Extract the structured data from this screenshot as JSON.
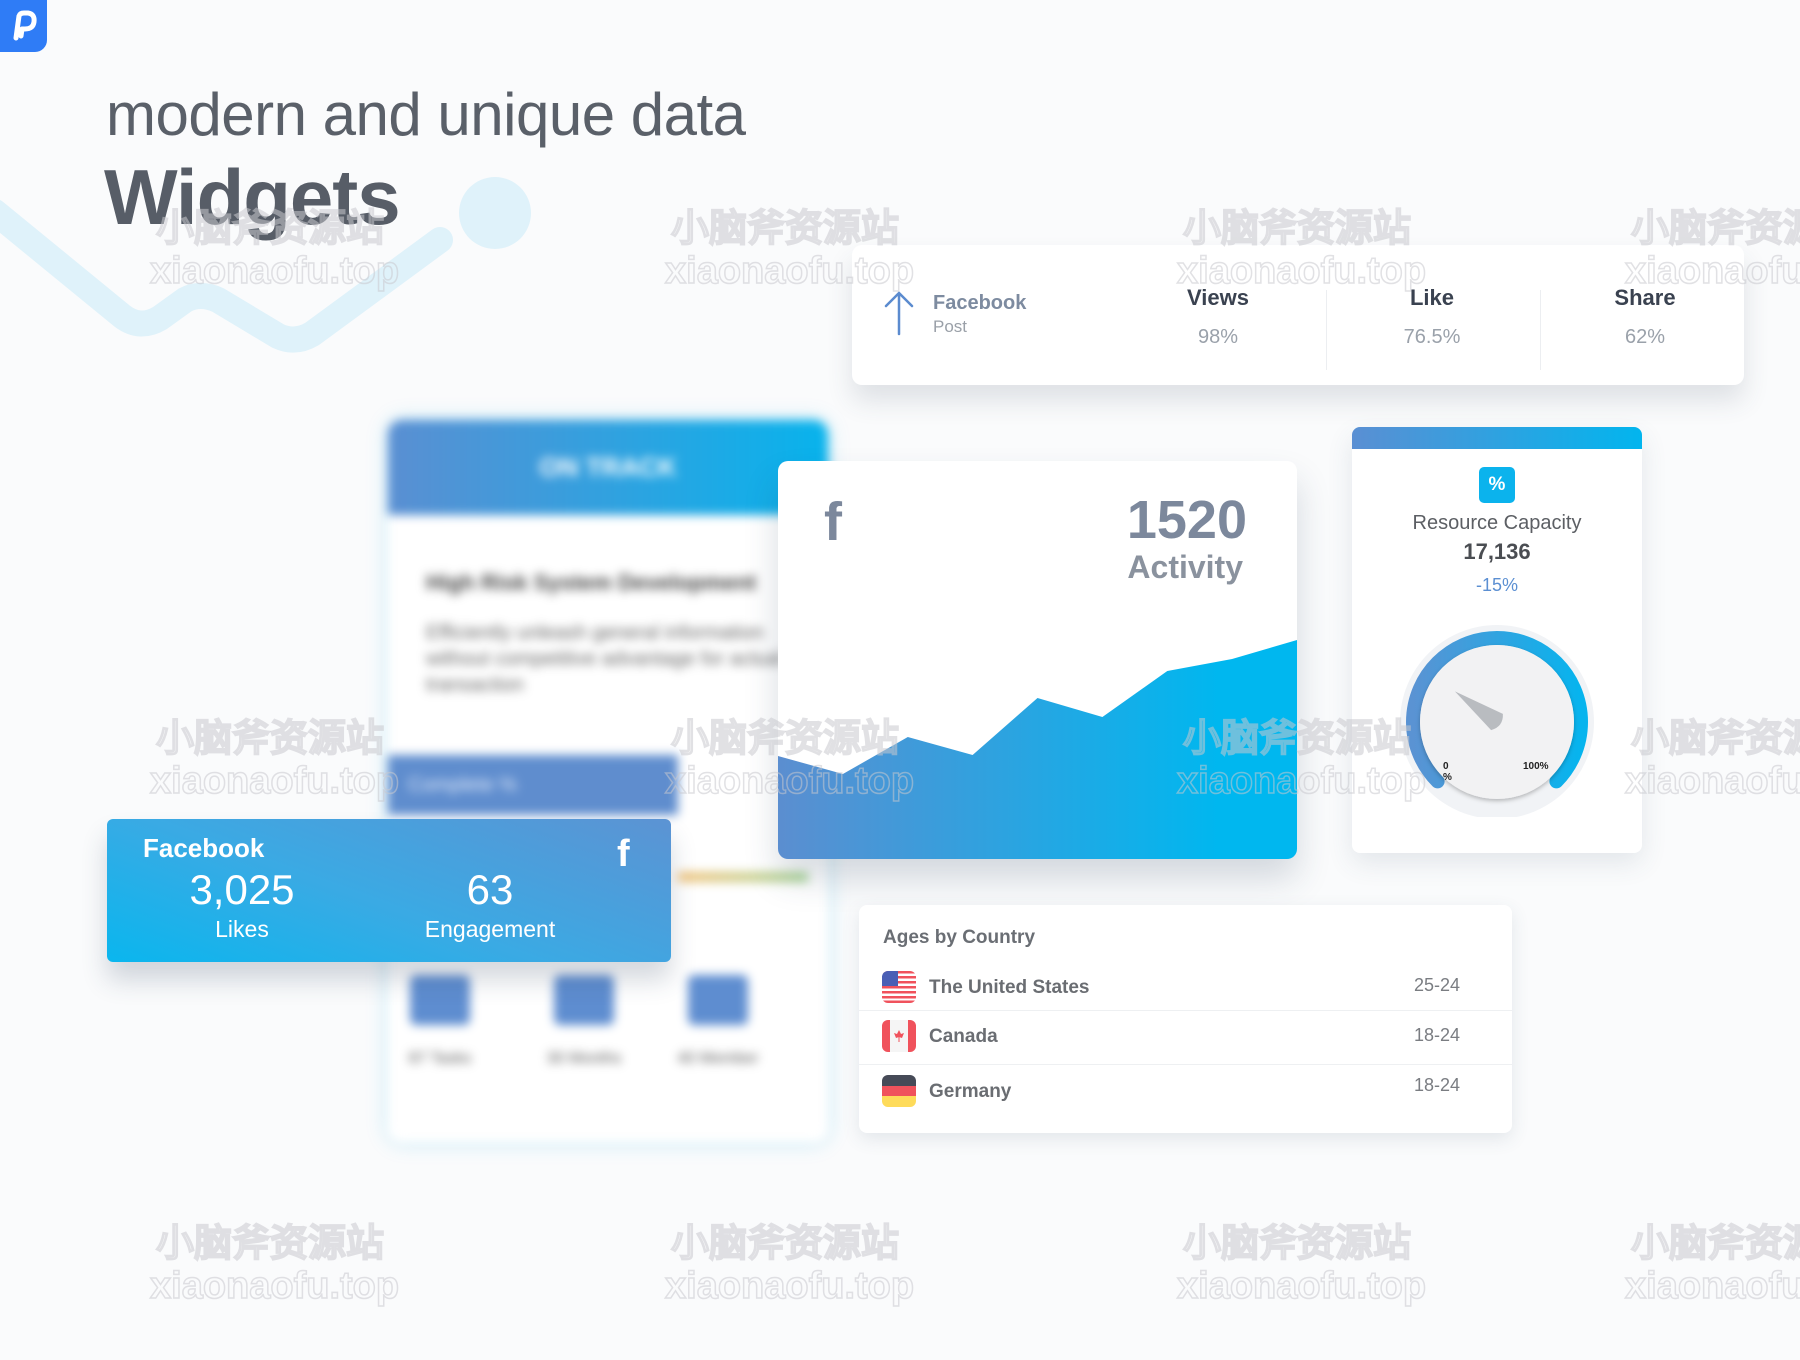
{
  "brand": {
    "logo_icon": "p-logo-icon",
    "color": "#2f7cf6"
  },
  "heading": {
    "subtitle": "modern and unique data",
    "title": "Widgets"
  },
  "post_stats": {
    "icon": "arrow-up-icon",
    "network": "Facebook",
    "type": "Post",
    "stats": [
      {
        "label": "Views",
        "value": "98%"
      },
      {
        "label": "Like",
        "value": "76.5%"
      },
      {
        "label": "Share",
        "value": "62%"
      }
    ]
  },
  "project_card_blurred": {
    "status": "ON TRACK",
    "title": "High Risk System Development",
    "description": "Efficiently unleash general information without competitive advantage for actual transaction",
    "complete_label": "Complete %",
    "stats": [
      "87 Tasks",
      "30 Months",
      "40 Member"
    ]
  },
  "facebook_card": {
    "network": "Facebook",
    "icon": "facebook-icon",
    "metrics": [
      {
        "value": "3,025",
        "label": "Likes"
      },
      {
        "value": "63",
        "label": "Engagement"
      }
    ]
  },
  "activity_card": {
    "icon": "facebook-icon",
    "value": "1520",
    "label": "Activity",
    "colors": {
      "start": "#5b8ed0",
      "end": "#00b7ef"
    }
  },
  "resource_card": {
    "icon": "percent-icon",
    "icon_text": "%",
    "title": "Resource Capacity",
    "value": "17,136",
    "change": "-15%",
    "gauge": {
      "min_label": "0\n%",
      "max_label": "100%",
      "level_percent": 30
    }
  },
  "ages_card": {
    "title": "Ages by Country",
    "rows": [
      {
        "flag": "us-flag-icon",
        "country": "The United States",
        "age": "25-24"
      },
      {
        "flag": "canada-flag-icon",
        "country": "Canada",
        "age": "18-24"
      },
      {
        "flag": "germany-flag-icon",
        "country": "Germany",
        "age": "18-24"
      }
    ]
  },
  "watermark": {
    "line1": "小脑斧资源站",
    "line2": "xiaonaofu.top"
  },
  "chart_data": {
    "type": "area",
    "title": "Activity",
    "x": [
      1,
      2,
      3,
      4,
      5,
      6,
      7,
      8,
      9
    ],
    "values": [
      103,
      85,
      122,
      104,
      161,
      142,
      188,
      200,
      219
    ],
    "xlabel": "",
    "ylabel": "",
    "ylim": [
      0,
      398
    ],
    "grid": false,
    "legend": "none"
  }
}
